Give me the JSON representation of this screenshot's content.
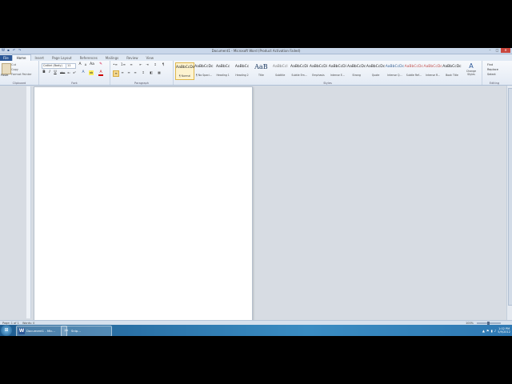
{
  "window": {
    "title": "Document1 - Microsoft Word (Product Activation Failed)",
    "quick_access": [
      "save-icon",
      "undo-icon",
      "redo-icon"
    ],
    "controls": [
      "minimize",
      "maximize",
      "close"
    ]
  },
  "ribbon": {
    "tabs": [
      "File",
      "Home",
      "Insert",
      "Page Layout",
      "References",
      "Mailings",
      "Review",
      "View"
    ],
    "active_tab": "Home",
    "clipboard": {
      "label": "Clipboard",
      "paste": "Paste",
      "items": [
        "Cut",
        "Copy",
        "Format Painter"
      ]
    },
    "font": {
      "label": "Font",
      "family": "Calibri (Body)",
      "size": "11",
      "buttons": [
        "A",
        "A",
        "Aa",
        "B",
        "I",
        "U",
        "abc",
        "x₂",
        "x²",
        "A",
        "ab",
        "A"
      ]
    },
    "paragraph": {
      "label": "Paragraph",
      "buttons": [
        "≡",
        "≡",
        "≡",
        "≡",
        "↕",
        "¶",
        "☰",
        "☰",
        "☰",
        "☰"
      ]
    },
    "styles": {
      "label": "Styles",
      "items": [
        {
          "sample": "AaBbCcDc",
          "name": "¶ Normal",
          "selected": true
        },
        {
          "sample": "AaBbCcDc",
          "name": "¶ No Spaci..."
        },
        {
          "sample": "AaBbCc",
          "name": "Heading 1"
        },
        {
          "sample": "AaBbCc",
          "name": "Heading 2"
        },
        {
          "sample": "AaB",
          "name": "Title",
          "big": true
        },
        {
          "sample": "AaBbCcI",
          "name": "Subtitle",
          "grey": true
        },
        {
          "sample": "AaBbCcDi",
          "name": "Subtle Em..."
        },
        {
          "sample": "AaBbCcDi",
          "name": "Emphasis"
        },
        {
          "sample": "AaBbCcDi",
          "name": "Intense E..."
        },
        {
          "sample": "AaBbCcDc",
          "name": "Strong"
        },
        {
          "sample": "AaBbCcDc",
          "name": "Quote"
        },
        {
          "sample": "AaBbCcDc",
          "name": "Intense Q...",
          "blue": true
        },
        {
          "sample": "AaBbCcDc",
          "name": "Subtle Ref...",
          "red": true
        },
        {
          "sample": "AaBbCcDc",
          "name": "Intense R...",
          "red": true
        },
        {
          "sample": "AaBbCcDc",
          "name": "Book Title"
        }
      ],
      "change_styles": "Change Styles"
    },
    "editing": {
      "label": "Editing",
      "items": [
        "Find",
        "Replace",
        "Select"
      ]
    }
  },
  "statusbar": {
    "page": "Page: 1 of 1",
    "words": "Words: 0",
    "zoom": "100%"
  },
  "taskbar": {
    "items": [
      {
        "label": "Document1 - Mic...",
        "icon": "W"
      },
      {
        "label": "Snip...",
        "icon": "✂"
      }
    ],
    "time": "1:02 PM",
    "date": "5/9/2012"
  }
}
